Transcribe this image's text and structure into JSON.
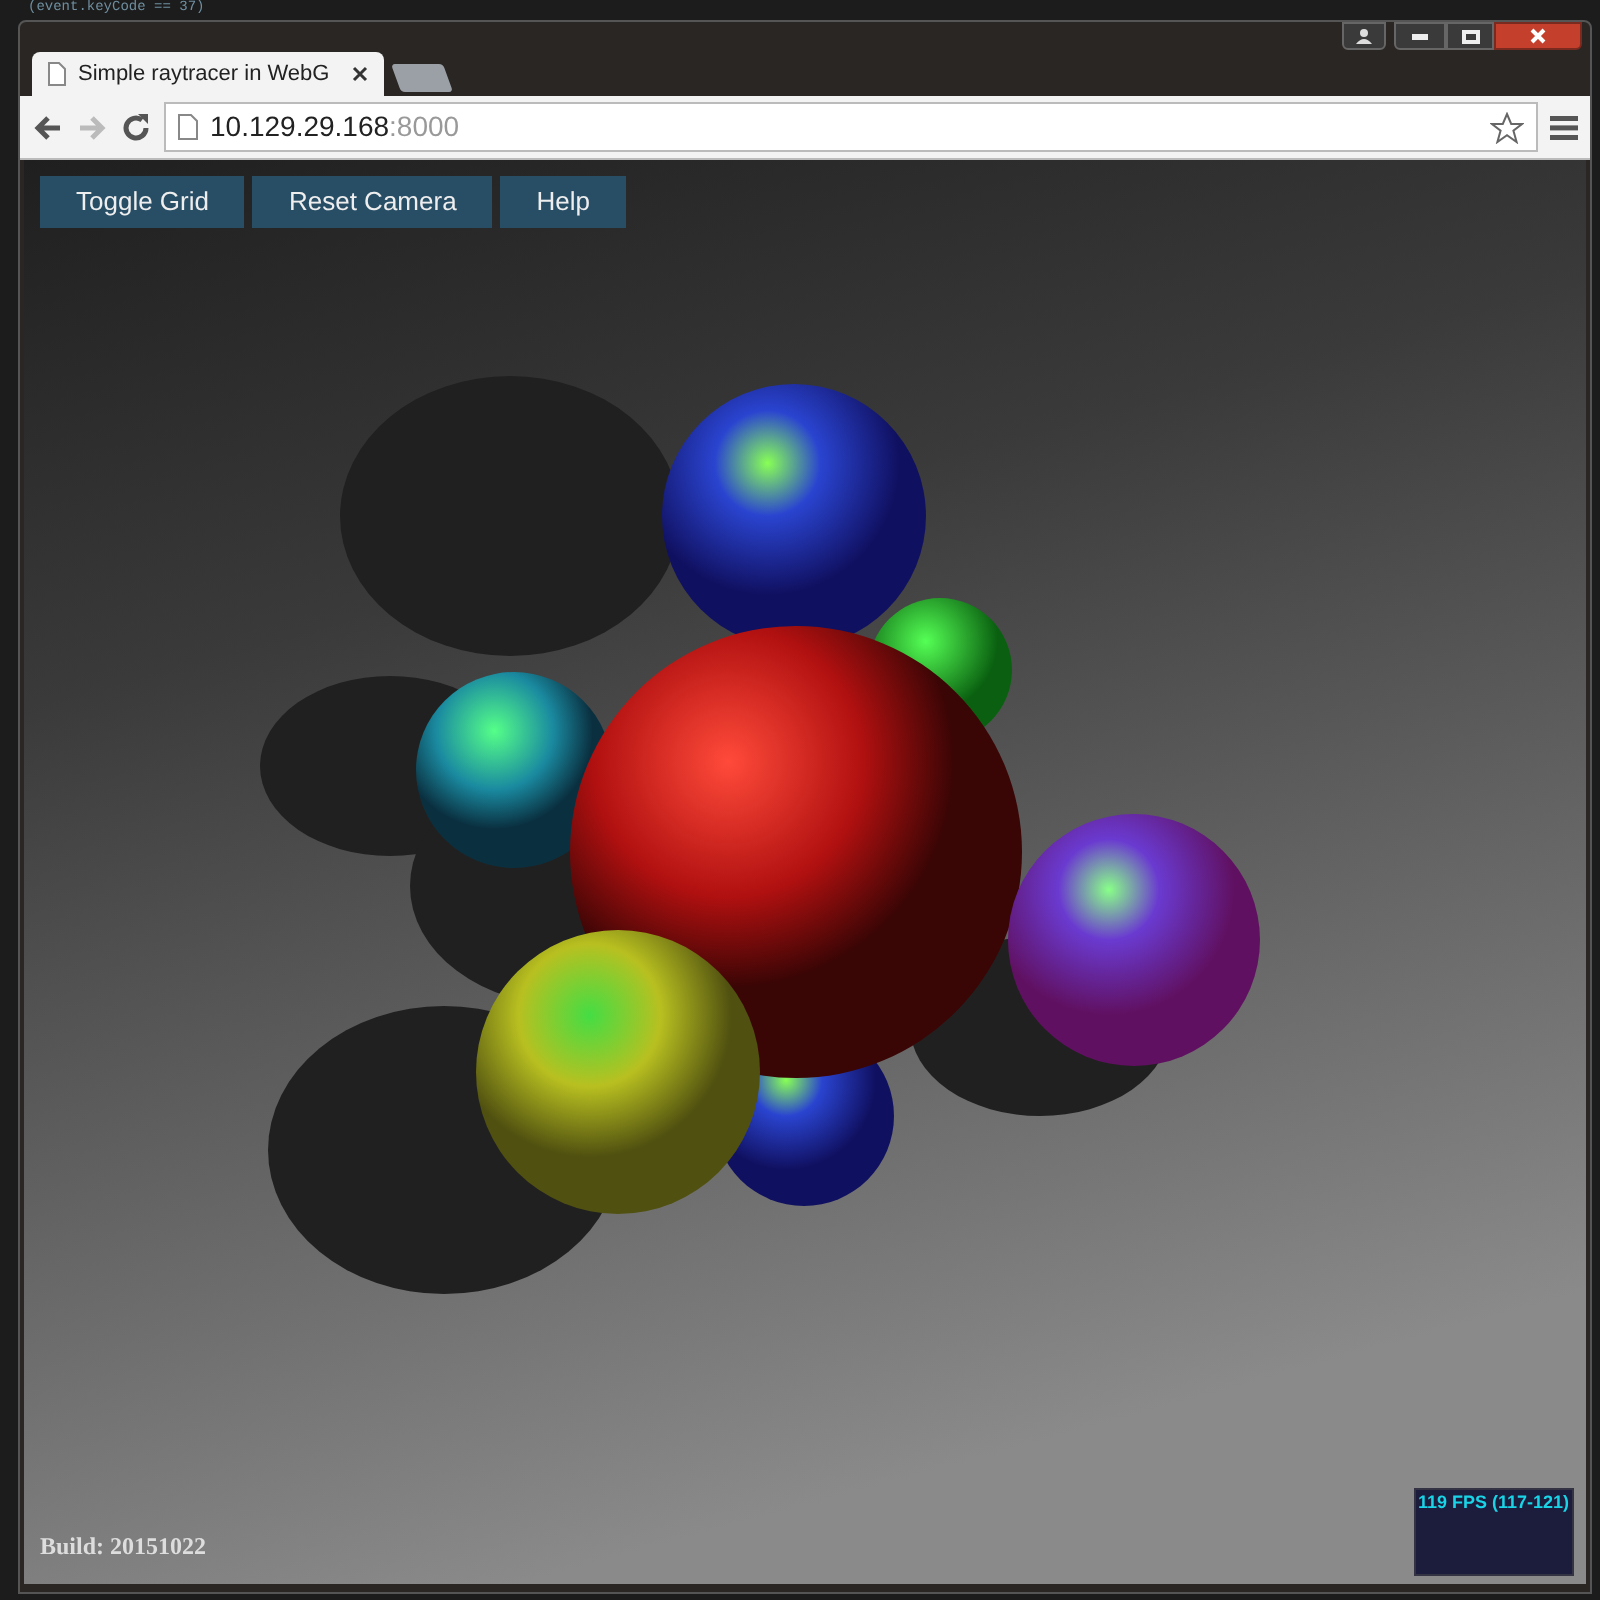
{
  "background_editor": {
    "code_line": "(event.keyCode == 37)"
  },
  "browser": {
    "tabs": [
      {
        "label": "Simple raytracer in WebG",
        "selected": true
      }
    ],
    "navigation": [
      {
        "kind": "back",
        "disabled": false
      },
      {
        "kind": "forward",
        "disabled": true
      },
      {
        "kind": "reload",
        "disabled": false
      }
    ],
    "address": {
      "host": "10.129.29.168",
      "port": ":8000"
    }
  },
  "page": {
    "buttons": [
      "Toggle Grid",
      "Reset Camera",
      "Help"
    ],
    "build": "Build: 20151022",
    "fps": "119 FPS (117-121)"
  }
}
